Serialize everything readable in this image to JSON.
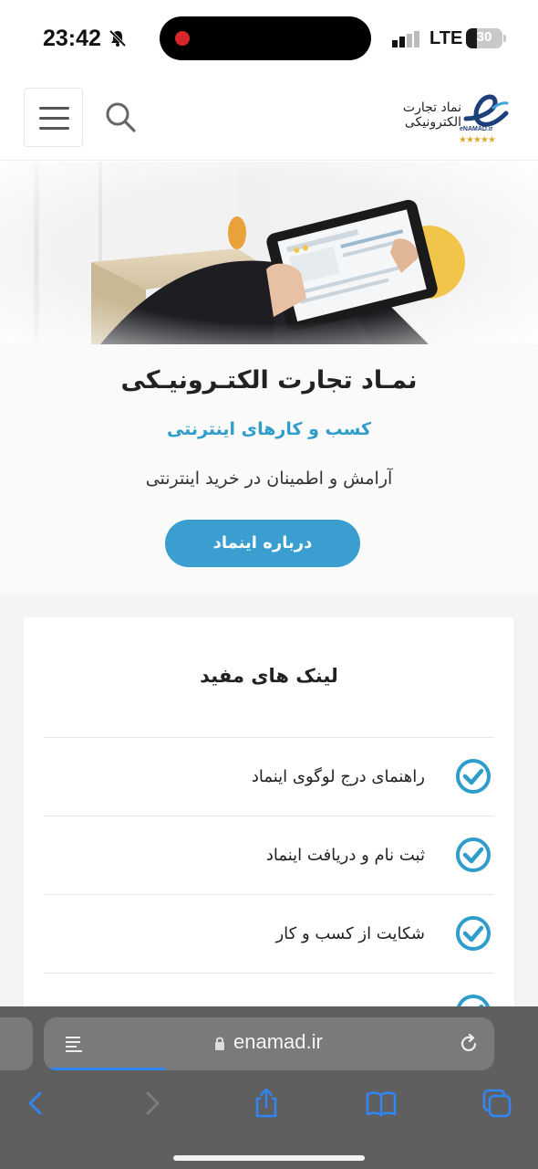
{
  "status_bar": {
    "time": "23:42",
    "network": "LTE",
    "battery_percent": "30",
    "battery_level": 0.3
  },
  "header": {
    "logo_text": "نماد تجارت الکترونیکی",
    "logo_sub": "eNAMAD.ir",
    "logo_stars": "★★★★★"
  },
  "hero": {
    "title": "نمـاد تجارت الکتـرونیـکی",
    "subtitle": "کسب و کارهای اینترنتی",
    "description": "آرامش و اطمینان در خرید اینترنتی",
    "button_label": "درباره اینماد"
  },
  "useful_links": {
    "title": "لینک های مفید",
    "items": [
      {
        "label": "راهنمای درج لوگوی اینماد",
        "icon": "check-circle-icon"
      },
      {
        "label": "ثبت نام و دریافت اینماد",
        "icon": "check-circle-icon"
      },
      {
        "label": "شکایت از کسب و کار",
        "icon": "check-circle-icon"
      },
      {
        "label": "",
        "icon": "check-circle-icon"
      }
    ]
  },
  "browser": {
    "url": "enamad.ir",
    "load_progress": 0.27
  },
  "colors": {
    "accent": "#3a9fd0",
    "subtitle": "#2f9dcb",
    "check": "#2f9dcb",
    "browser_bar": "#5f5f5f"
  }
}
